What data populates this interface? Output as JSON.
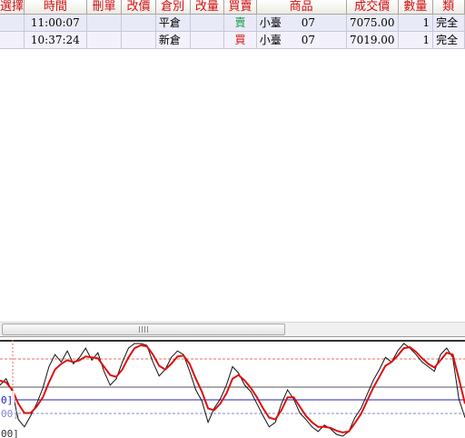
{
  "table": {
    "headers": [
      "選擇",
      "時間",
      "刪單",
      "改價",
      "倉別",
      "改量",
      "買賣",
      "商品",
      "成交價",
      "數量",
      "類"
    ],
    "rows": [
      {
        "time": "11:00:07",
        "delete": "",
        "modify_price": "",
        "position": "平倉",
        "modify_qty": "",
        "side": "賣",
        "product": "小臺",
        "month": "07",
        "price": "7075.00",
        "qty": "1",
        "status": "完全"
      },
      {
        "time": "10:37:24",
        "delete": "",
        "modify_price": "",
        "position": "新倉",
        "modify_qty": "",
        "side": "買",
        "product": "小臺",
        "month": "07",
        "price": "7019.00",
        "qty": "1",
        "status": "完全"
      }
    ]
  },
  "colors": {
    "header_text": "#d01010",
    "sell": "#119944",
    "buy": "#dd1111",
    "fast_line": "#111111",
    "slow_line": "#dd1111",
    "band_line": "#2222bb"
  },
  "chart": {
    "y_labels": [
      "0]",
      "00]",
      "00]"
    ],
    "fast_values": [
      0.55,
      0.62,
      0.48,
      0.18,
      0.1,
      0.22,
      0.35,
      0.52,
      0.75,
      0.88,
      0.8,
      0.92,
      0.78,
      0.85,
      0.95,
      0.82,
      0.9,
      0.7,
      0.55,
      0.62,
      0.8,
      0.95,
      1.0,
      1.0,
      0.98,
      0.8,
      0.65,
      0.72,
      0.85,
      0.92,
      0.88,
      0.7,
      0.5,
      0.38,
      0.15,
      0.3,
      0.4,
      0.55,
      0.75,
      0.68,
      0.55,
      0.48,
      0.35,
      0.22,
      0.1,
      0.15,
      0.35,
      0.5,
      0.4,
      0.25,
      0.18,
      0.1,
      0.05,
      0.12,
      0.08,
      0.02,
      0.0,
      0.05,
      0.2,
      0.3,
      0.45,
      0.6,
      0.72,
      0.85,
      0.8,
      0.92,
      1.0,
      0.95,
      0.88,
      0.8,
      0.75,
      0.7,
      0.88,
      0.95,
      0.85,
      0.4,
      0.2
    ],
    "slow_values": [
      0.6,
      0.58,
      0.5,
      0.35,
      0.25,
      0.25,
      0.32,
      0.42,
      0.58,
      0.72,
      0.78,
      0.82,
      0.8,
      0.82,
      0.86,
      0.85,
      0.84,
      0.75,
      0.66,
      0.64,
      0.72,
      0.85,
      0.95,
      0.98,
      0.97,
      0.88,
      0.76,
      0.72,
      0.78,
      0.86,
      0.87,
      0.78,
      0.62,
      0.48,
      0.3,
      0.28,
      0.35,
      0.46,
      0.62,
      0.66,
      0.6,
      0.52,
      0.42,
      0.3,
      0.2,
      0.18,
      0.28,
      0.42,
      0.42,
      0.32,
      0.22,
      0.15,
      0.1,
      0.1,
      0.09,
      0.06,
      0.04,
      0.05,
      0.14,
      0.24,
      0.38,
      0.52,
      0.64,
      0.76,
      0.8,
      0.87,
      0.95,
      0.96,
      0.91,
      0.84,
      0.78,
      0.74,
      0.82,
      0.9,
      0.88,
      0.62,
      0.35
    ],
    "upper_band": 0.8,
    "mid_band": 0.5,
    "lower_band": 0.2
  }
}
